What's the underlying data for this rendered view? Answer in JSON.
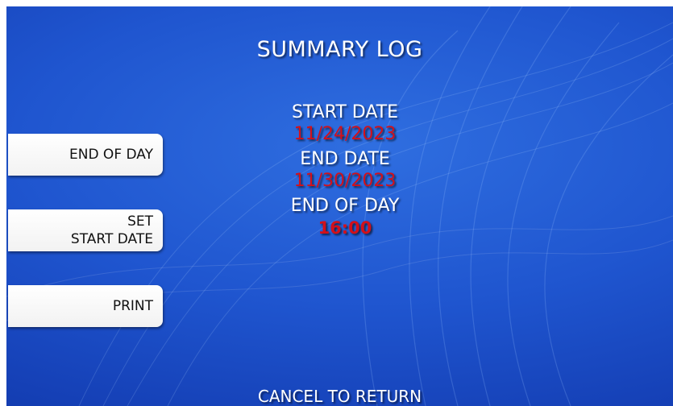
{
  "screen": {
    "title": "SUMMARY LOG",
    "footer": "CANCEL TO RETURN"
  },
  "info": {
    "start_date_label": "START DATE",
    "start_date_value": "11/24/2023",
    "end_date_label": "END DATE",
    "end_date_value": "11/30/2023",
    "end_of_day_label": "END OF DAY",
    "end_of_day_value": "16:00"
  },
  "buttons": {
    "end_of_day": "END OF DAY",
    "set_start_date_line1": "SET",
    "set_start_date_line2": "START DATE",
    "print": "PRINT"
  },
  "colors": {
    "background": "#1f55cf",
    "value_text": "#d3101a",
    "label_text": "#ffffff",
    "button": "#ffffff"
  }
}
